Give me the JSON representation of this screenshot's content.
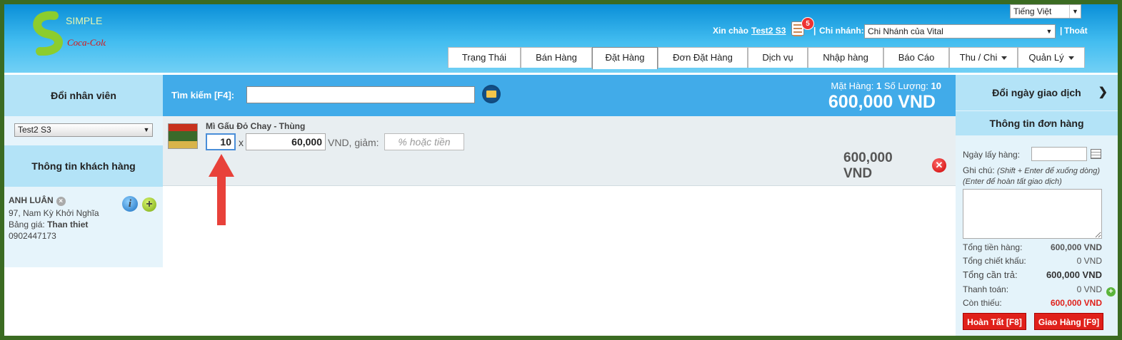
{
  "header": {
    "logo_text": "SIMPLE",
    "logo_brand": "Coca-Cola",
    "language": "Tiếng Việt",
    "greeting": "Xin chào",
    "user": "Test2 S3",
    "notif_count": "5",
    "branch_label": "Chi nhánh:",
    "branch_value": "Chi Nhánh của Vital",
    "logout": "Thoát"
  },
  "nav": {
    "tabs": [
      "Trạng Thái",
      "Bán Hàng",
      "Đặt Hàng",
      "Đơn Đặt Hàng",
      "Dịch vụ",
      "Nhập hàng",
      "Báo Cáo",
      "Thu / Chi",
      "Quản Lý"
    ],
    "active": "Đặt Hàng"
  },
  "left": {
    "employee_header": "Đổi nhân viên",
    "employee_value": "Test2 S3",
    "customer_header": "Thông tin khách hàng",
    "customer_name": "ANH LUÂN",
    "customer_address": "97, Nam Kỳ Khởi Nghĩa",
    "price_list_label": "Bảng giá:",
    "price_list_value": "Than thiet",
    "phone": "0902447173"
  },
  "search": {
    "label": "Tìm kiếm [F4]:",
    "value": "",
    "items_label": "Mặt Hàng:",
    "items_count": "1",
    "qty_label": "Số Lượng:",
    "qty_count": "10",
    "total": "600,000 VND"
  },
  "item": {
    "name": "Mì Gấu Đỏ Chay - Thùng",
    "qty": "10",
    "times": "x",
    "price": "60,000",
    "vnd_discount": "VND, giảm:",
    "discount_placeholder": "% hoặc tiền",
    "line_total": "600,000 VND"
  },
  "right": {
    "change_date": "Đổi ngày giao dịch",
    "order_info": "Thông tin đơn hàng",
    "pickup_label": "Ngày lấy hàng:",
    "note_label": "Ghi chú:",
    "note_hint1": "(Shift + Enter để xuống dòng)",
    "note_hint2": "(Enter để hoàn tất giao dịch)",
    "summary": [
      {
        "label": "Tổng tiền hàng:",
        "value": "600,000 VND"
      },
      {
        "label": "Tổng chiết khấu:",
        "value": "0 VND"
      },
      {
        "label": "Tổng cần trả:",
        "value": "600,000 VND"
      },
      {
        "label": "Thanh toán:",
        "value": "0 VND"
      },
      {
        "label": "Còn thiếu:",
        "value": "600,000 VND"
      }
    ],
    "btn_complete": "Hoàn Tất [F8]",
    "btn_deliver": "Giao Hàng [F9]"
  },
  "colors": {
    "accent": "#41abe9",
    "danger": "#e0211b",
    "frame": "#3b6b22"
  }
}
